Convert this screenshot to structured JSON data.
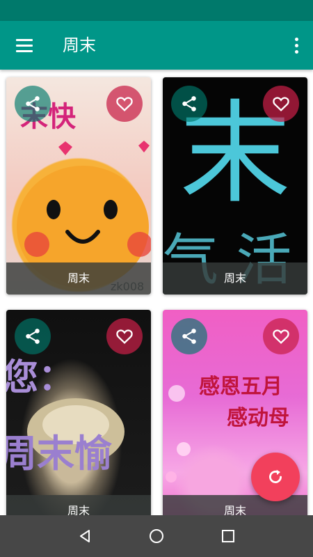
{
  "app_bar": {
    "title": "周末",
    "menu_icon": "menu-icon",
    "more_icon": "more-vert-icon"
  },
  "cards": [
    {
      "caption": "周末",
      "share_icon": "share-icon",
      "fav_icon": "heart-outline-icon"
    },
    {
      "caption": "周末",
      "share_icon": "share-icon",
      "fav_icon": "heart-outline-icon"
    },
    {
      "caption": "周末",
      "share_icon": "share-icon",
      "fav_icon": "heart-outline-icon"
    },
    {
      "caption": "周末",
      "share_icon": "share-icon",
      "fav_icon": "heart-outline-icon"
    }
  ],
  "image_text": {
    "card1_top": "末快",
    "card1_watermark": "zk008",
    "card2_big": "末",
    "card2_bottom": "气 活",
    "card3_line1": "您：",
    "card3_line2": "周末愉",
    "card4_line1": "感恩五月",
    "card4_line2": "感动母"
  },
  "fab": {
    "icon": "refresh-icon"
  },
  "nav": {
    "back_icon": "back-icon",
    "home_icon": "home-icon",
    "recents_icon": "recents-icon"
  },
  "colors": {
    "primary": "#009688",
    "primary_dark": "#00796b",
    "accent": "#f2405c",
    "nav_bar": "#474747"
  }
}
